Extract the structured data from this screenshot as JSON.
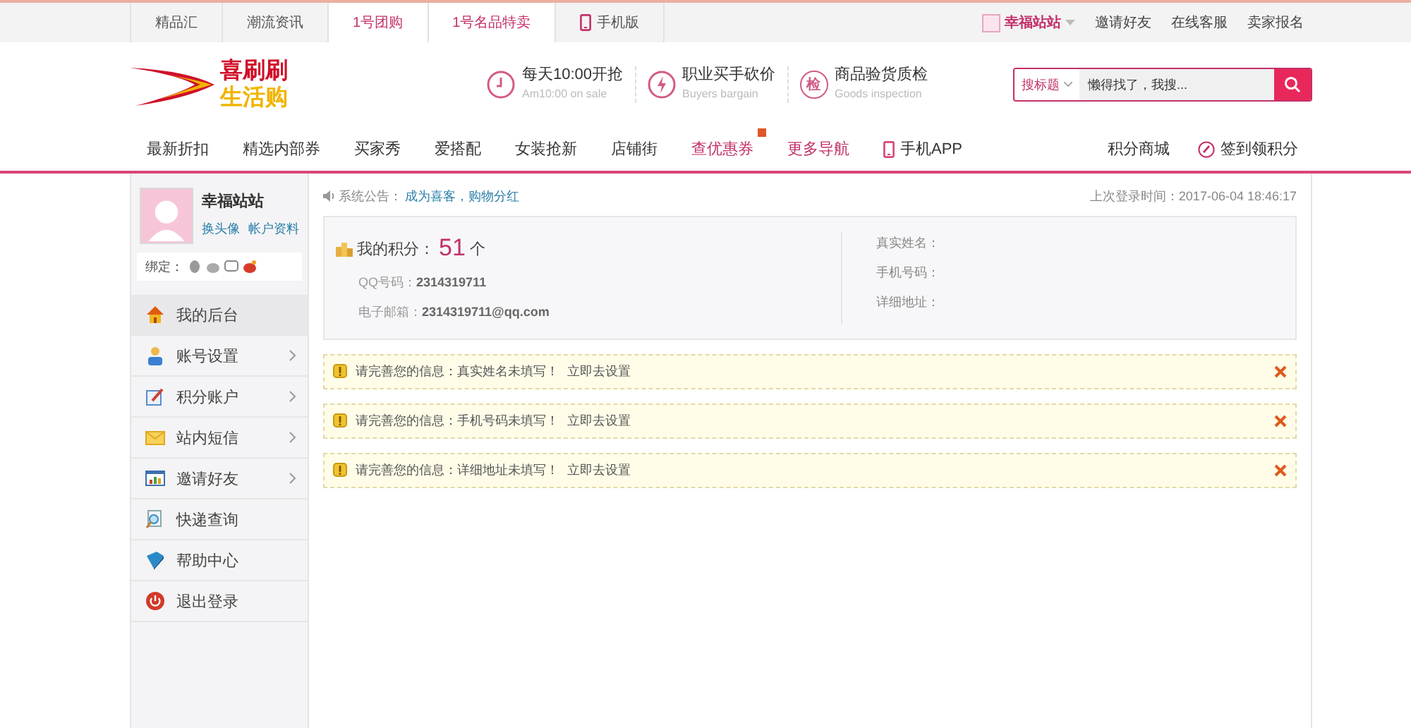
{
  "top_bar": {
    "tabs": [
      {
        "label": "精品汇",
        "selected": false,
        "kind": "text"
      },
      {
        "label": "潮流资讯",
        "selected": false,
        "kind": "text"
      },
      {
        "label": "1号团购",
        "selected": true,
        "kind": "text"
      },
      {
        "label": "1号名品特卖",
        "selected": true,
        "kind": "text"
      },
      {
        "label": "手机版",
        "selected": false,
        "kind": "phone"
      }
    ],
    "user": {
      "name": "幸福站站"
    },
    "links": [
      "邀请好友",
      "在线客服",
      "卖家报名"
    ]
  },
  "header": {
    "logo": {
      "line_1": "喜刷刷",
      "line_2": "生活购"
    },
    "features": [
      {
        "kind": "clock",
        "title": "每天10:00开抢",
        "subtitle": "Am10:00 on sale"
      },
      {
        "kind": "bolt",
        "title": "职业买手砍价",
        "subtitle": "Buyers bargain"
      },
      {
        "kind": "glyph",
        "icon_text": "检",
        "title": "商品验货质检",
        "subtitle": "Goods inspection"
      }
    ],
    "search": {
      "scope": "搜标题",
      "placeholder": "懒得找了，我搜..."
    }
  },
  "nav": {
    "items": [
      {
        "label": "最新折扣",
        "highlighted": false,
        "kind": "text",
        "badge": false
      },
      {
        "label": "精选内部券",
        "highlighted": false,
        "kind": "text",
        "badge": false
      },
      {
        "label": "买家秀",
        "highlighted": false,
        "kind": "text",
        "badge": false
      },
      {
        "label": "爱搭配",
        "highlighted": false,
        "kind": "text",
        "badge": false
      },
      {
        "label": "女装抢新",
        "highlighted": false,
        "kind": "text",
        "badge": false
      },
      {
        "label": "店铺街",
        "highlighted": false,
        "kind": "text",
        "badge": false
      },
      {
        "label": "查优惠券",
        "highlighted": true,
        "kind": "text",
        "badge": true
      },
      {
        "label": "更多导航",
        "highlighted": true,
        "kind": "text",
        "badge": false
      },
      {
        "label": "手机APP",
        "highlighted": false,
        "kind": "phone",
        "badge": false
      }
    ],
    "right": [
      {
        "label": "积分商城",
        "kind": "text"
      },
      {
        "label": "签到领积分",
        "kind": "signin"
      }
    ]
  },
  "sidebar": {
    "profile": {
      "name": "幸福站站",
      "links": [
        "换头像",
        "帐户资料"
      ]
    },
    "bind": {
      "label": "绑定："
    },
    "menu": [
      {
        "label": "我的后台",
        "kind": "home",
        "selected": true,
        "expandable": false
      },
      {
        "label": "账号设置",
        "kind": "user",
        "selected": false,
        "expandable": true
      },
      {
        "label": "积分账户",
        "kind": "edit",
        "selected": false,
        "expandable": true
      },
      {
        "label": "站内短信",
        "kind": "mail",
        "selected": false,
        "expandable": true
      },
      {
        "label": "邀请好友",
        "kind": "chart",
        "selected": false,
        "expandable": true
      },
      {
        "label": "快递查询",
        "kind": "search",
        "selected": false,
        "expandable": false
      },
      {
        "label": "帮助中心",
        "kind": "help",
        "selected": false,
        "expandable": false
      },
      {
        "label": "退出登录",
        "kind": "power",
        "selected": false,
        "expandable": false
      }
    ]
  },
  "main": {
    "notice": {
      "label": "系统公告：",
      "link": "成为喜客，购物分红"
    },
    "last_login": "上次登录时间：2017-06-04 18:46:17",
    "points": {
      "label": "我的积分：",
      "value": "51",
      "unit": "个"
    },
    "left_fields": [
      {
        "label": "QQ号码：",
        "value": "2314319711"
      },
      {
        "label": "电子邮箱：",
        "value": "2314319711@qq.com"
      }
    ],
    "right_fields": [
      {
        "label": "真实姓名："
      },
      {
        "label": "手机号码："
      },
      {
        "label": "详细地址："
      }
    ],
    "alerts": [
      {
        "message": "请完善您的信息：真实姓名未填写！",
        "action": "立即去设置"
      },
      {
        "message": "请完善您的信息：手机号码未填写！",
        "action": "立即去设置"
      },
      {
        "message": "请完善您的信息：详细地址未填写！",
        "action": "立即去设置"
      }
    ]
  }
}
